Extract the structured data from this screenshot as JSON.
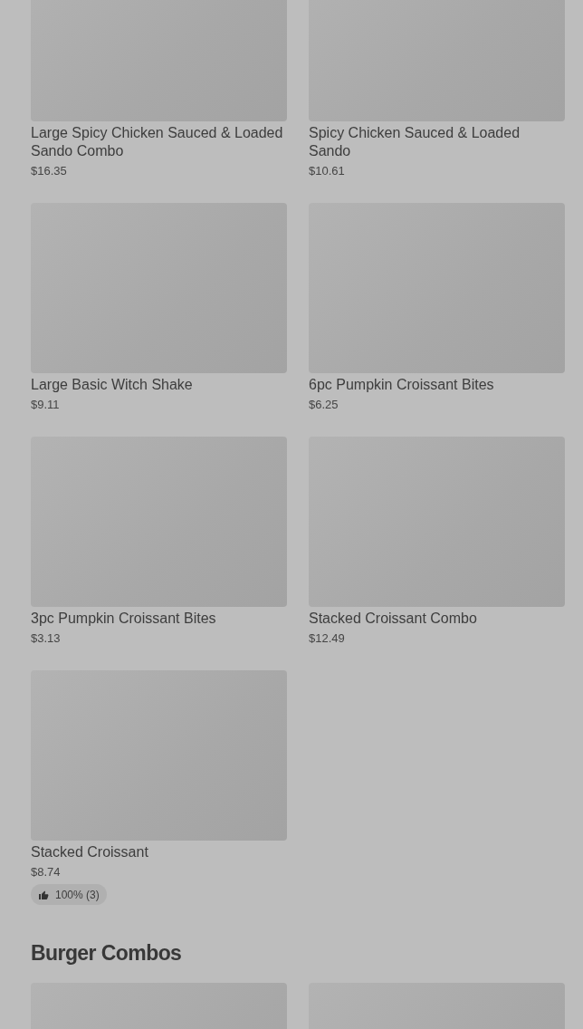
{
  "sections": [
    {
      "items": [
        {
          "kind": "product",
          "name": "Large Spicy Chicken Sauced & Loaded Sando Combo",
          "price": "$16.35"
        },
        {
          "kind": "product",
          "name": "Spicy Chicken Sauced & Loaded Sando",
          "price": "$10.61"
        },
        {
          "kind": "product",
          "name": "Large Basic Witch Shake",
          "price": "$9.11"
        },
        {
          "kind": "product",
          "name": "6pc Pumpkin Croissant Bites",
          "price": "$6.25"
        },
        {
          "kind": "product",
          "name": "3pc Pumpkin Croissant Bites",
          "price": "$3.13"
        },
        {
          "kind": "product",
          "name": "Stacked Croissant Combo",
          "price": "$12.49"
        },
        {
          "kind": "product",
          "name": "Stacked Croissant",
          "price": "$8.74",
          "rating": "100% (3)"
        }
      ]
    },
    {
      "title": "Burger Combos",
      "items": [
        {
          "kind": "image-only"
        },
        {
          "kind": "image-only"
        }
      ]
    }
  ]
}
